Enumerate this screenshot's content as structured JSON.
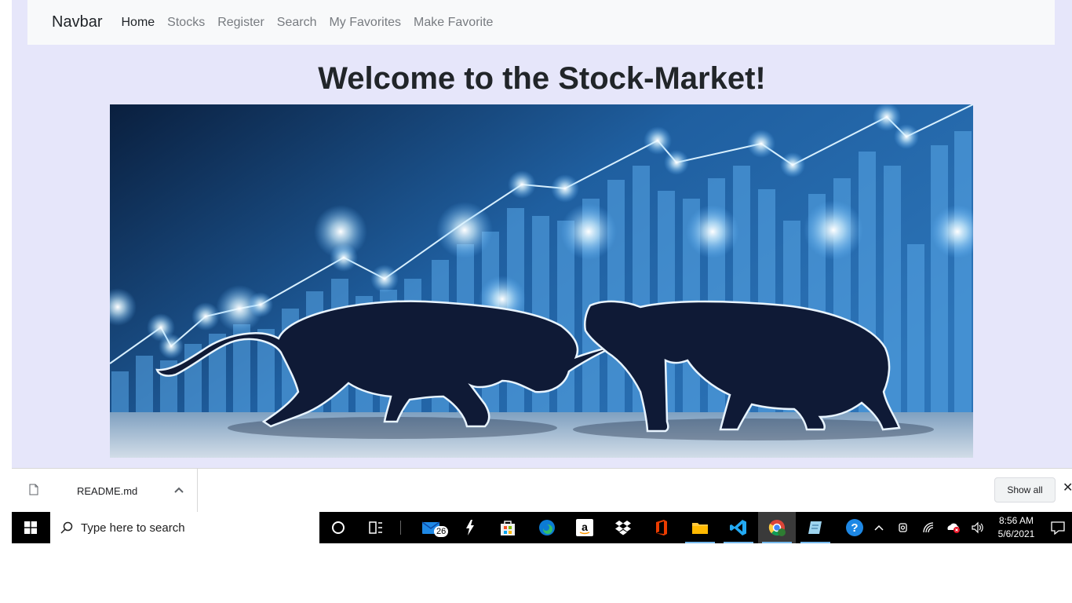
{
  "navbar": {
    "brand": "Navbar",
    "links": [
      "Home",
      "Stocks",
      "Register",
      "Search",
      "My Favorites",
      "Make Favorite"
    ]
  },
  "main": {
    "title": "Welcome to the Stock-Market!"
  },
  "downloads": {
    "file_name": "README.md",
    "show_all": "Show all",
    "close": "✕"
  },
  "taskbar": {
    "search_placeholder": "Type here to search",
    "mail_badge": "26",
    "time": "8:56 AM",
    "date": "5/6/2021"
  }
}
